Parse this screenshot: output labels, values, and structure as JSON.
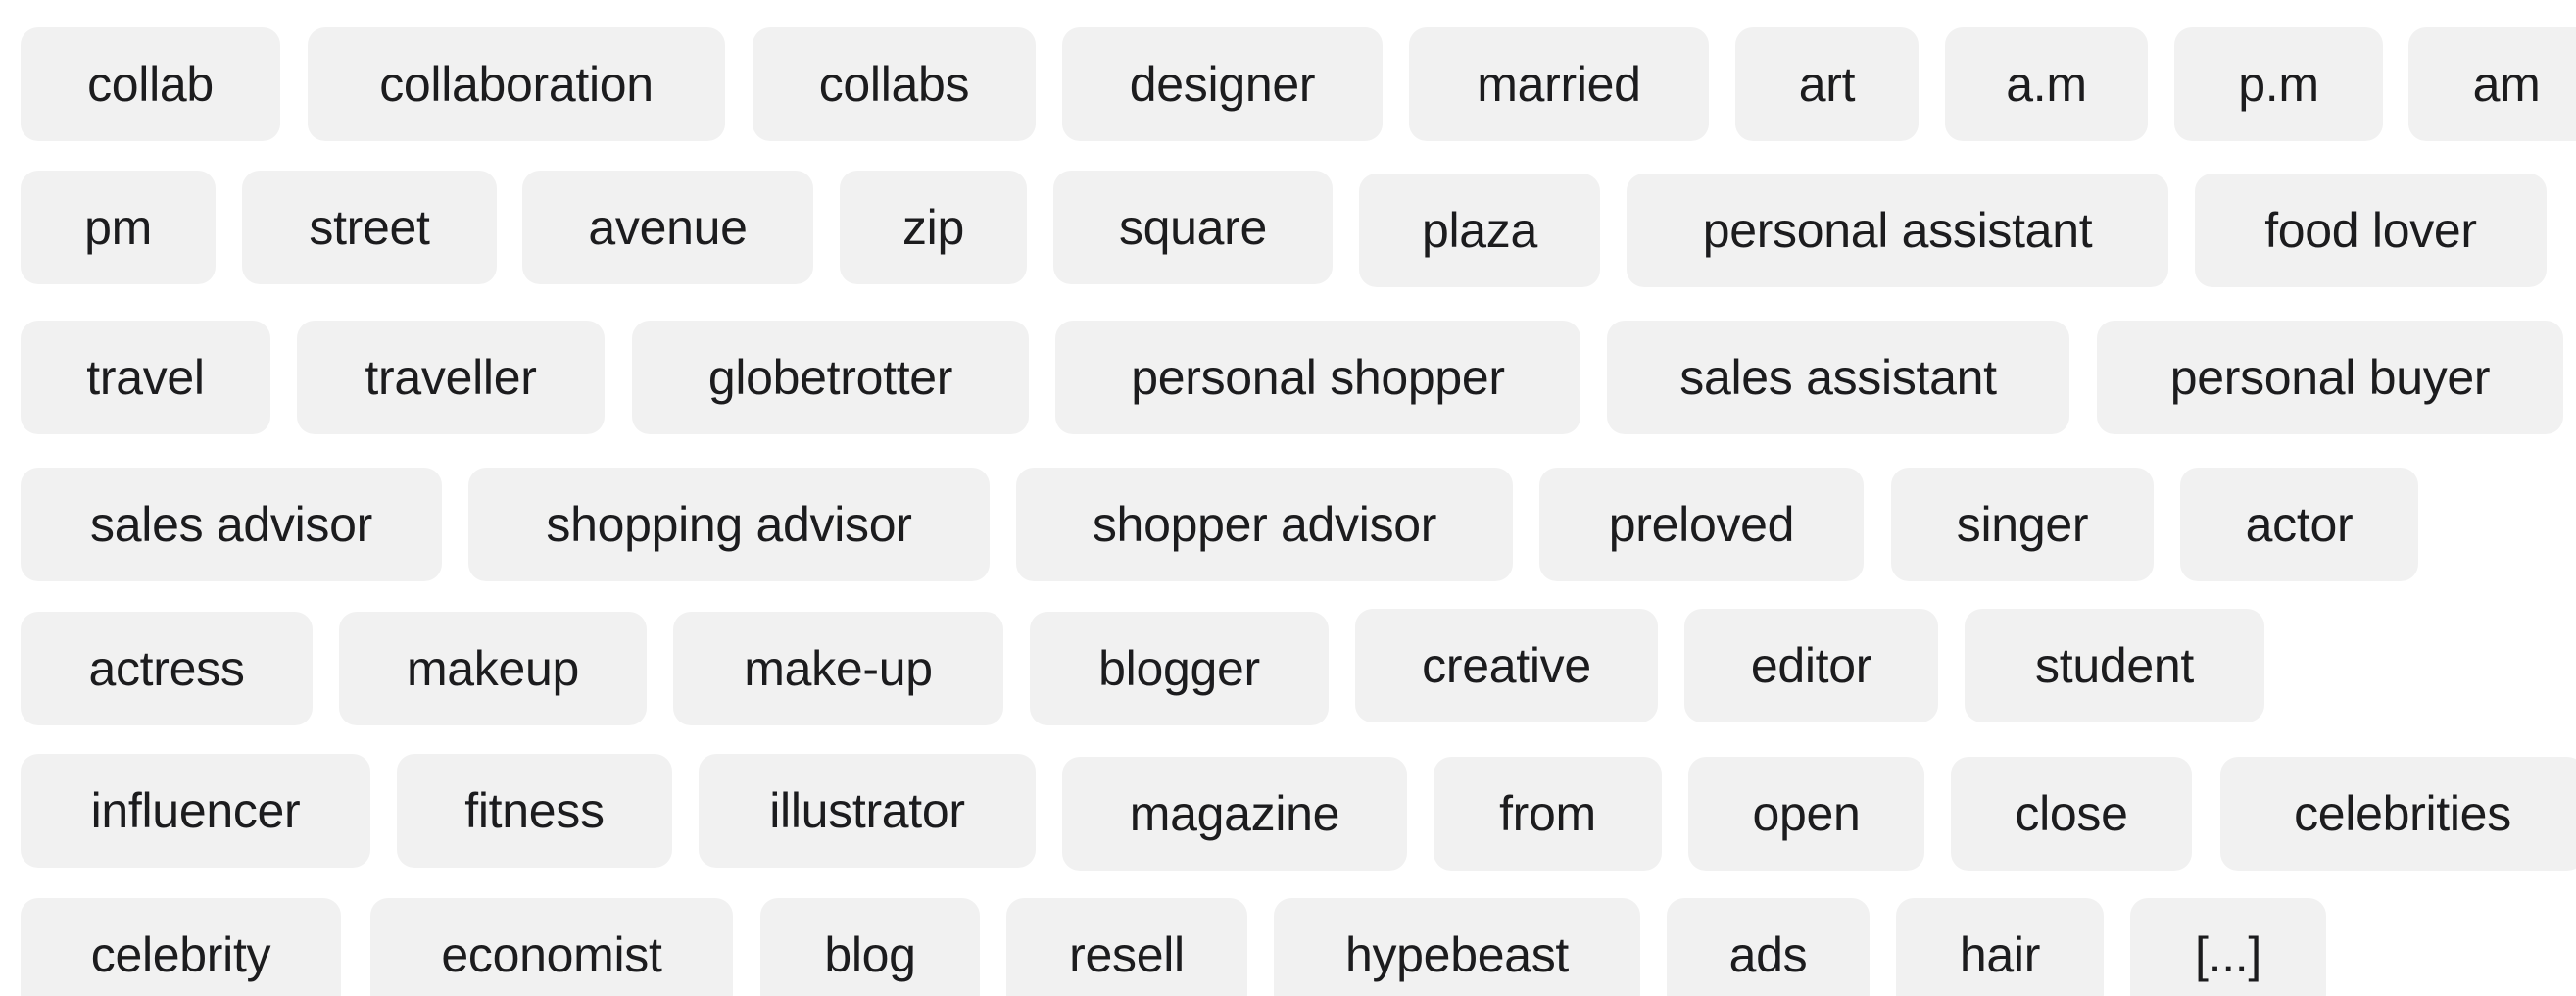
{
  "tags": {
    "row1": [
      "collab",
      "collaboration",
      "collabs",
      "designer",
      "married",
      "art",
      "a.m",
      "p.m",
      "am"
    ],
    "row2": [
      "pm",
      "street",
      "avenue",
      "zip",
      "square",
      "plaza",
      "personal assistant",
      "food lover"
    ],
    "row3": [
      "travel",
      "traveller",
      "globetrotter",
      "personal shopper",
      "sales assistant",
      "personal buyer"
    ],
    "row4": [
      "sales advisor",
      "shopping advisor",
      "shopper advisor",
      "preloved",
      "singer",
      "actor"
    ],
    "row5": [
      "actress",
      "makeup",
      "make-up",
      "blogger",
      "creative",
      "editor",
      "student"
    ],
    "row6": [
      "influencer",
      "fitness",
      "illustrator",
      "magazine",
      "from",
      "open",
      "close",
      "celebrities"
    ],
    "row7": [
      "celebrity",
      "economist",
      "blog",
      "resell",
      "hypebeast",
      "ads",
      "hair",
      "[...]"
    ]
  },
  "colors": {
    "chip_background": "#f1f1f1",
    "chip_text": "#1c1c1e",
    "page_background": "#ffffff"
  }
}
